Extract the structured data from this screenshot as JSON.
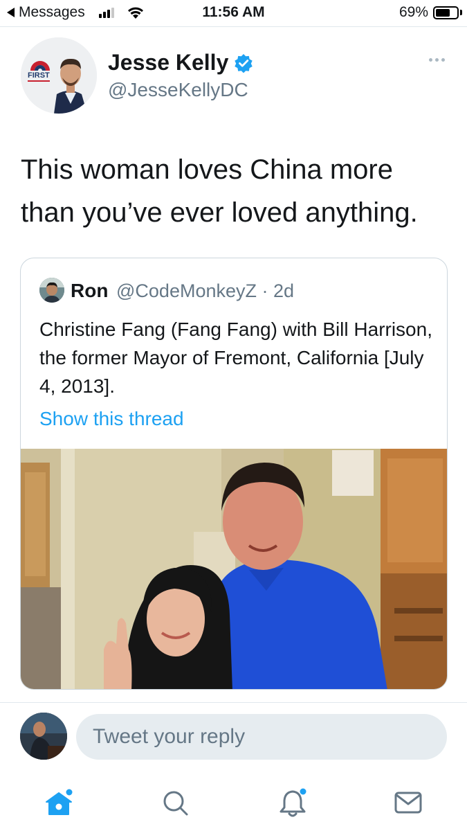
{
  "status_bar": {
    "back_label": "Messages",
    "time": "11:56 AM",
    "battery_percent": "69%",
    "battery_level": 0.69,
    "signal_bars": 3
  },
  "tweet": {
    "author_name": "Jesse Kelly",
    "author_handle": "@JesseKellyDC",
    "avatar_badge_text": "FIRST",
    "verified": true,
    "text": "This woman loves China more than you’ve ever loved anything."
  },
  "quoted_tweet": {
    "author_name": "Ron",
    "author_handle": "@CodeMonkeyZ · 2d",
    "text": "Christine Fang (Fang Fang) with Bill Harrison, the former Mayor of Fremont, California [July 4, 2013].",
    "thread_link": "Show this thread"
  },
  "reply": {
    "placeholder": "Tweet your reply"
  },
  "tab_bar": {
    "items": [
      "home-icon",
      "search-icon",
      "notifications-icon",
      "messages-icon"
    ]
  },
  "colors": {
    "accent": "#1da1f2",
    "secondary_text": "#657786",
    "input_bg": "#e6ecf0"
  }
}
